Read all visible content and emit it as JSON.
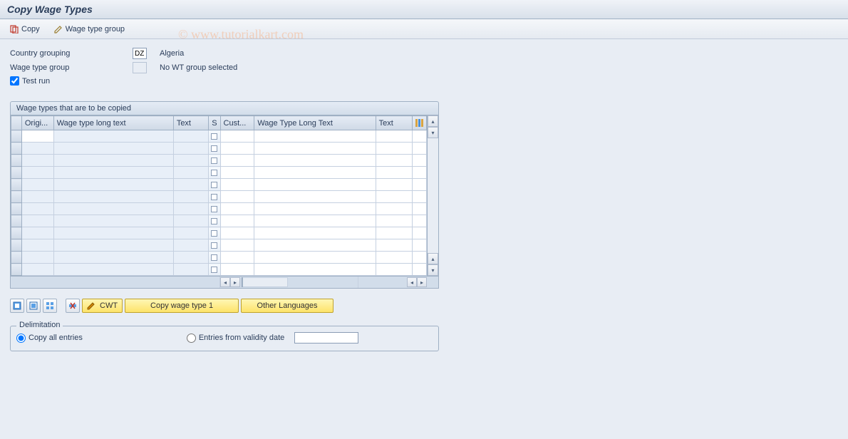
{
  "title": "Copy Wage Types",
  "toolbar": {
    "copy_label": "Copy",
    "wtg_label": "Wage type group"
  },
  "watermark": "© www.tutorialkart.com",
  "fields": {
    "country_grouping_label": "Country grouping",
    "country_grouping_value": "DZ",
    "country_grouping_desc": "Algeria",
    "wt_group_label": "Wage type group",
    "wt_group_value": "",
    "wt_group_desc": "No WT group selected",
    "testrun_label": "Test run"
  },
  "table": {
    "title": "Wage types that are to be copied",
    "cols": {
      "origi": "Origi...",
      "wtlt": "Wage type long text",
      "text": "Text",
      "s": "S",
      "cust": "Cust...",
      "wtlt2": "Wage Type Long Text",
      "text2": "Text"
    },
    "row_count": 12
  },
  "buttons": {
    "cwt_label": "CWT",
    "copy1_label": "Copy wage type 1",
    "other_lang_label": "Other Languages"
  },
  "delim": {
    "title": "Delimitation",
    "copy_all_label": "Copy all entries",
    "entries_from_label": "Entries from validity date",
    "date_value": ""
  }
}
